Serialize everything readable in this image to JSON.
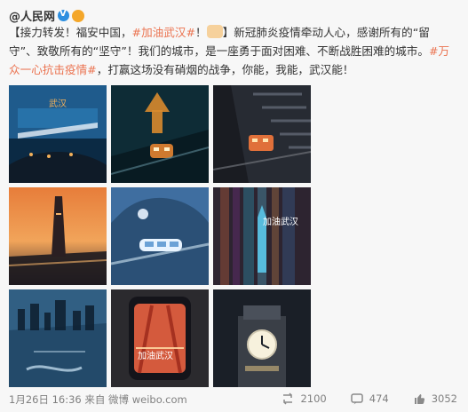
{
  "post": {
    "author": "@人民网",
    "text_parts": {
      "p1": "【接力转发！福安中国，",
      "tag1": "#加油武汉#",
      "p2": "！",
      "p3": "】新冠肺炎疫情牵动人心，感谢所有的“留守”、致敬所有的“坚守”！我们的城市，是一座勇于面对困难、不断战胜困难的城市。",
      "tag2": "#万众一心抗击疫情#",
      "p4": "，打赢这场没有硝烟的战争，你能，我能，武汉能！"
    }
  },
  "images": [
    {
      "name": "pic-airport",
      "bg": "#1f5b8c",
      "accent": "#f2b05a",
      "label": "武汉"
    },
    {
      "name": "pic-yellow-crane-tower-train",
      "bg": "#0e2c36",
      "accent": "#d88a2d"
    },
    {
      "name": "pic-bridge-train",
      "bg": "#1a1c22",
      "accent": "#e0703a"
    },
    {
      "name": "pic-bridge-sunset",
      "bg": "#b95a2a",
      "accent": "#f6b46a"
    },
    {
      "name": "pic-light-rail",
      "bg": "#3f6ea0",
      "accent": "#d0e6f4"
    },
    {
      "name": "pic-night-tower",
      "bg": "#2d2430",
      "accent": "#58c1e3",
      "label": "加油武汉"
    },
    {
      "name": "pic-waterfront-skyline",
      "bg": "#315f83",
      "accent": "#bcd6e8"
    },
    {
      "name": "pic-phone-bridge",
      "bg": "#2b2a2e",
      "accent": "#d45a3d",
      "label": "加油武汉"
    },
    {
      "name": "pic-clock-tower",
      "bg": "#1a1f27",
      "accent": "#f2d28a"
    }
  ],
  "footer": {
    "date": "1月26日 16:36 来自 微博 weibo.com",
    "reposts": "2100",
    "comments": "474",
    "likes": "3052"
  }
}
